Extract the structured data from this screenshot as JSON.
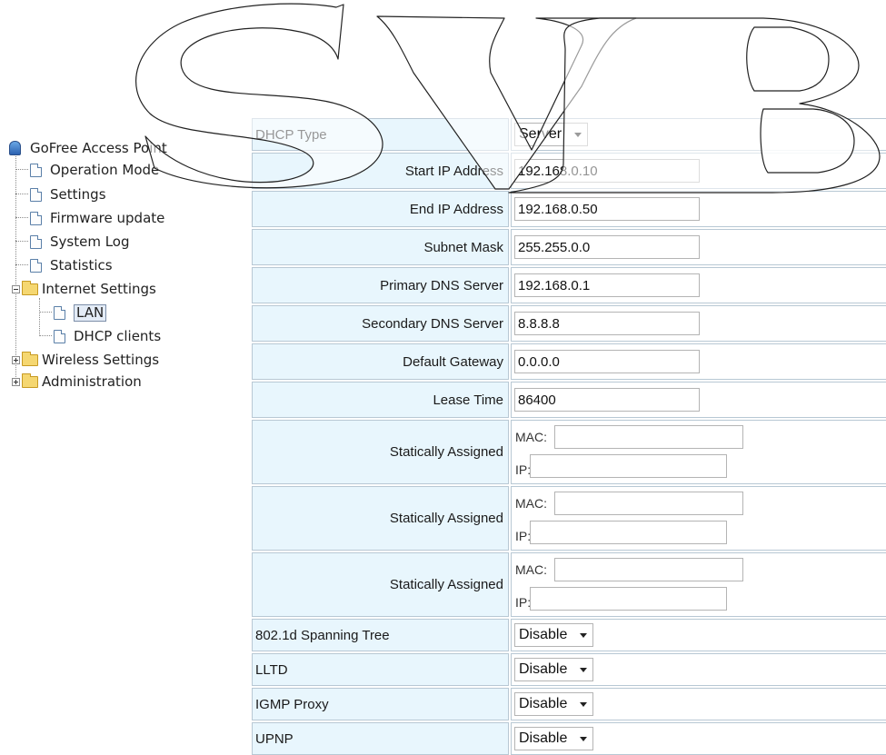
{
  "nav": {
    "root_label": "GoFree Access Point",
    "items": [
      {
        "label": "Operation Mode"
      },
      {
        "label": "Settings"
      },
      {
        "label": "Firmware update"
      },
      {
        "label": "System Log"
      },
      {
        "label": "Statistics"
      },
      {
        "label": "Internet Settings",
        "expanded": true,
        "children": [
          {
            "label": "LAN",
            "selected": true
          },
          {
            "label": "DHCP clients"
          }
        ]
      },
      {
        "label": "Wireless Settings",
        "expanded": false
      },
      {
        "label": "Administration",
        "expanded": false
      }
    ]
  },
  "form": {
    "dhcp_type": {
      "label": "DHCP Type",
      "value": "Server"
    },
    "start_ip": {
      "label": "Start IP Address",
      "value": "192.168.0.10"
    },
    "end_ip": {
      "label": "End IP Address",
      "value": "192.168.0.50"
    },
    "subnet_mask": {
      "label": "Subnet Mask",
      "value": "255.255.0.0"
    },
    "primary_dns": {
      "label": "Primary DNS Server",
      "value": "192.168.0.1"
    },
    "secondary_dns": {
      "label": "Secondary DNS Server",
      "value": "8.8.8.8"
    },
    "default_gateway": {
      "label": "Default Gateway",
      "value": "0.0.0.0"
    },
    "lease_time": {
      "label": "Lease Time",
      "value": "86400"
    },
    "static_assignments": [
      {
        "label": "Statically Assigned",
        "mac_label": "MAC:",
        "ip_label": "IP:",
        "mac": "",
        "ip": ""
      },
      {
        "label": "Statically Assigned",
        "mac_label": "MAC:",
        "ip_label": "IP:",
        "mac": "",
        "ip": ""
      },
      {
        "label": "Statically Assigned",
        "mac_label": "MAC:",
        "ip_label": "IP:",
        "mac": "",
        "ip": ""
      }
    ],
    "spanning_tree": {
      "label": "802.1d Spanning Tree",
      "value": "Disable"
    },
    "lltd": {
      "label": "LLTD",
      "value": "Disable"
    },
    "igmp_proxy": {
      "label": "IGMP Proxy",
      "value": "Disable"
    },
    "upnp": {
      "label": "UPNP",
      "value": "Disable"
    }
  },
  "watermark": {
    "text": "SVB"
  }
}
